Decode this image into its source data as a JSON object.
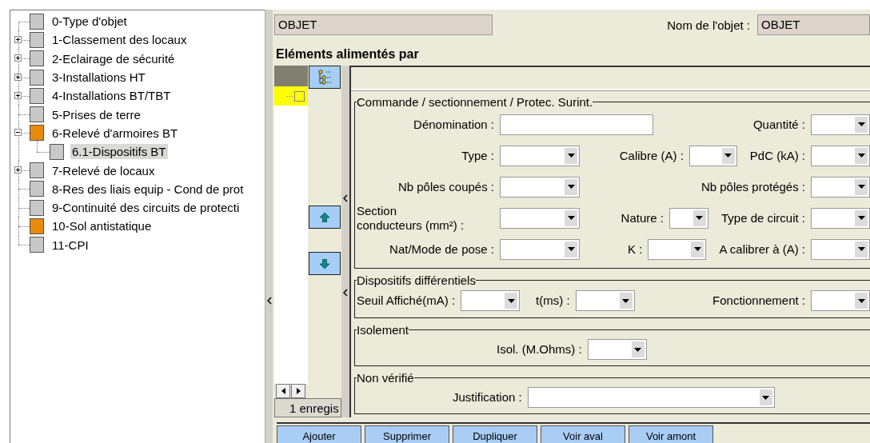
{
  "tree": {
    "items": [
      {
        "label": "0-Type d'objet",
        "color": "#c8c8c8",
        "selected": false
      },
      {
        "label": "1-Classement des locaux",
        "color": "#c8c8c8",
        "expanded": false,
        "selected": false
      },
      {
        "label": "2-Eclairage de sécurité",
        "color": "#c8c8c8",
        "expanded": false,
        "selected": false
      },
      {
        "label": "3-Installations HT",
        "color": "#c8c8c8",
        "expanded": false,
        "selected": false
      },
      {
        "label": "4-Installations BT/TBT",
        "color": "#c8c8c8",
        "expanded": false,
        "selected": false
      },
      {
        "label": "5-Prises de terre",
        "color": "#c8c8c8",
        "selected": false
      },
      {
        "label": "6-Relevé d'armoires BT",
        "color": "#e88a0c",
        "expanded": true,
        "selected": false,
        "children": [
          {
            "label": "6.1-Dispositifs BT",
            "color": "#c8c8c8",
            "selected": true
          }
        ]
      },
      {
        "label": "7-Relevé de locaux",
        "color": "#c8c8c8",
        "expanded": false,
        "selected": false
      },
      {
        "label": "8-Res des liais equip - Cond de prot",
        "color": "#c8c8c8",
        "selected": false
      },
      {
        "label": "9-Continuité des circuits de protecti",
        "color": "#c8c8c8",
        "selected": false
      },
      {
        "label": "10-Sol antistatique",
        "color": "#e88a0c",
        "selected": false
      },
      {
        "label": "11-CPI",
        "color": "#c8c8c8",
        "selected": false
      }
    ]
  },
  "header": {
    "object_field": {
      "value": "OBJET"
    },
    "name_label": "Nom de l'objet :",
    "name_field": {
      "value": "OBJET"
    }
  },
  "section_title": "Eléments alimentés par",
  "record_list": {
    "rows": [
      {
        "selected": true
      }
    ],
    "status": "1 enregis"
  },
  "groups": [
    {
      "title": "Commande / sectionnement / Protec. Surint.",
      "rows": [
        {
          "fields": [
            {
              "label": "Dénomination :",
              "kind": "text"
            },
            {
              "label": "Quantité :",
              "kind": "combo"
            }
          ]
        },
        {
          "fields": [
            {
              "label": "Type :",
              "kind": "combo"
            },
            {
              "label": "Calibre (A) :",
              "kind": "combo"
            },
            {
              "label": "PdC (kA) :",
              "kind": "combo"
            }
          ]
        },
        {
          "fields": [
            {
              "label": "Nb pôles coupés :",
              "kind": "combo"
            },
            {
              "label": "Nb pôles protégés :",
              "kind": "combo"
            }
          ]
        },
        {
          "fields": [
            {
              "label": "Section\nconducteurs (mm²) :",
              "kind": "combo"
            },
            {
              "label": "Nature :",
              "kind": "combo"
            },
            {
              "label": "Type de circuit :",
              "kind": "combo"
            }
          ]
        },
        {
          "fields": [
            {
              "label": "Nat/Mode de pose :",
              "kind": "combo"
            },
            {
              "label": "K :",
              "kind": "combo"
            },
            {
              "label": "A calibrer à (A) :",
              "kind": "combo"
            }
          ]
        }
      ]
    },
    {
      "title": "Dispositifs différentiels",
      "rows": [
        {
          "fields": [
            {
              "label": "Seuil Affiché(mA) :",
              "kind": "combo"
            },
            {
              "label": "t(ms) :",
              "kind": "combo"
            },
            {
              "label": "Fonctionnement :",
              "kind": "combo"
            }
          ]
        }
      ]
    },
    {
      "title": "Isolement",
      "rows": [
        {
          "fields": [
            {
              "label": "Isol. (M.Ohms) :",
              "kind": "combo"
            }
          ]
        }
      ]
    },
    {
      "title": "Non vérifié",
      "rows": [
        {
          "fields": [
            {
              "label": "Justification :",
              "kind": "combo"
            }
          ]
        }
      ]
    }
  ],
  "buttons": [
    "Ajouter",
    "Supprimer",
    "Dupliquer",
    "Voir aval",
    "Voir amont"
  ]
}
